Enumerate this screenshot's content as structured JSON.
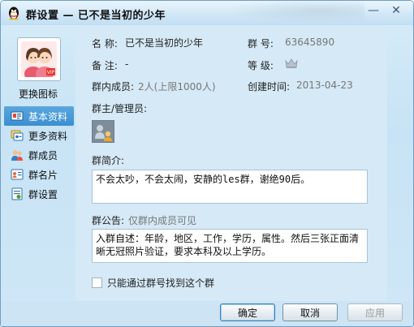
{
  "window": {
    "title": "群设置 — 已不是当初的少年",
    "minimize_glyph": "—",
    "close_glyph": "✕"
  },
  "left": {
    "change_icon_label": "更换图标",
    "nav": [
      {
        "label": "基本资料",
        "icon": "info-card-icon"
      },
      {
        "label": "更多资料",
        "icon": "more-info-icon"
      },
      {
        "label": "群成员",
        "icon": "members-icon"
      },
      {
        "label": "群名片",
        "icon": "group-card-icon"
      },
      {
        "label": "群设置",
        "icon": "settings-icon"
      }
    ]
  },
  "info": {
    "name_label": "名  称:",
    "name_value": "已不是当初的少年",
    "number_label": "群  号:",
    "number_value": "63645890",
    "remark_label": "备  注:",
    "remark_value": "-",
    "level_label": "等  级:",
    "members_label": "群内成员:",
    "members_value": "2人(上限1000人)",
    "created_label": "创建时间:",
    "created_value": "2013-04-23",
    "admins_label": "群主/管理员:"
  },
  "intro": {
    "label": "群简介:",
    "text": "不会太吵，不会太闹，安静的les群，谢绝90后。"
  },
  "notice": {
    "label": "群公告:",
    "hint": "仅群内成员可见",
    "text": "入群自述：年龄，地区，工作，学历，属性。然后三张正面清晰无冠照片验证，要求本科及以上学历。"
  },
  "search_option": {
    "label": "只能通过群号找到这个群",
    "checked": false
  },
  "buttons": {
    "ok": "确定",
    "cancel": "取消",
    "apply": "应用"
  },
  "colors": {
    "accent": "#3a8fd2",
    "panel": "#d5e9f6"
  }
}
